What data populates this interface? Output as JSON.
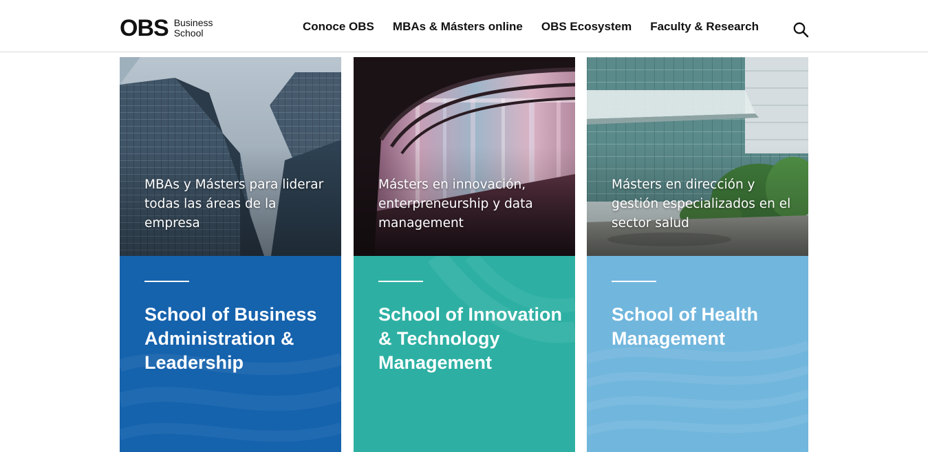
{
  "header": {
    "logo": {
      "mark": "OBS",
      "line1": "Business",
      "line2": "School"
    },
    "nav": [
      "Conoce OBS",
      "MBAs & Másters online",
      "OBS Ecosystem",
      "Faculty & Research"
    ],
    "search_icon": "search-icon"
  },
  "cards": [
    {
      "caption": "MBAs y Másters para liderar todas las áreas de la empresa",
      "title": "School of Business Administration & Leadership",
      "color": "#1562ad"
    },
    {
      "caption": "Másters en innovación, enterpreneurship y data management",
      "title": "School of Innovation & Technology Management",
      "color": "#2db0a3"
    },
    {
      "caption": "Másters en dirección y gestión especializados en el sector salud",
      "title": "School of Health Management",
      "color": "#71b6dd"
    }
  ]
}
